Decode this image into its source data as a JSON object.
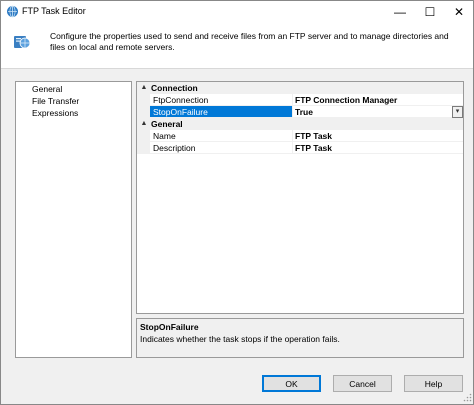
{
  "window": {
    "title": "FTP Task Editor",
    "minimize_glyph": "—",
    "maximize_glyph": "☐",
    "close_glyph": "✕"
  },
  "header": {
    "description": "Configure the properties used to send and receive files from an FTP server and to manage directories and files on local and remote servers.",
    "icon": "ftp-task-icon"
  },
  "nav": {
    "items": [
      "General",
      "File Transfer",
      "Expressions"
    ]
  },
  "grid": {
    "categories": [
      {
        "label": "Connection",
        "toggle": "▲",
        "properties": [
          {
            "name": "FtpConnection",
            "value": "FTP Connection Manager"
          },
          {
            "name": "StopOnFailure",
            "value": "True",
            "selected": true
          }
        ]
      },
      {
        "label": "General",
        "toggle": "▲",
        "properties": [
          {
            "name": "Name",
            "value": "FTP Task"
          },
          {
            "name": "Description",
            "value": "FTP Task"
          }
        ]
      }
    ],
    "dropdown_glyph": "▾"
  },
  "description_panel": {
    "title": "StopOnFailure",
    "text": "Indicates whether the task stops if the operation fails."
  },
  "buttons": {
    "ok": "OK",
    "cancel": "Cancel",
    "help": "Help"
  },
  "colors": {
    "selection": "#0078d7",
    "default_button_border": "#0078d7"
  }
}
